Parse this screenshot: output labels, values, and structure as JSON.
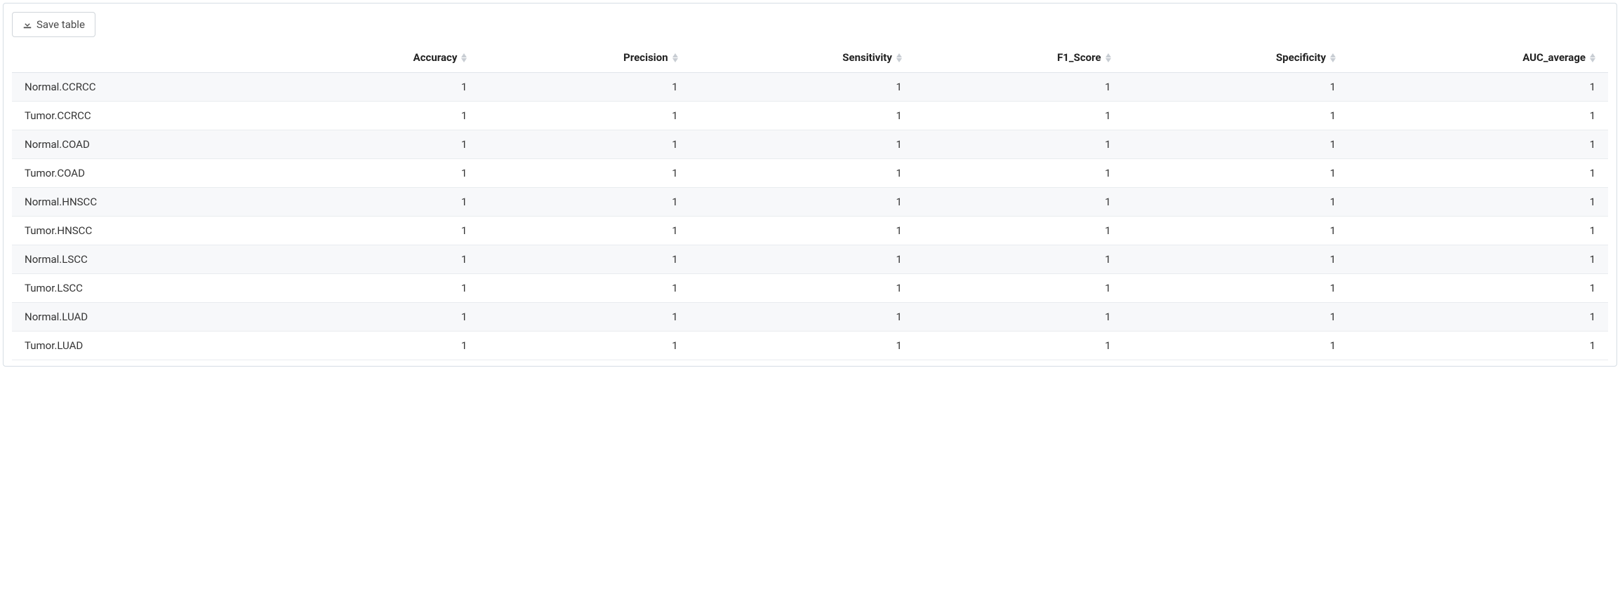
{
  "toolbar": {
    "save_label": "Save table"
  },
  "table": {
    "columns": [
      "",
      "Accuracy",
      "Precision",
      "Sensitivity",
      "F1_Score",
      "Specificity",
      "AUC_average"
    ],
    "rows": [
      {
        "label": "Normal.CCRCC",
        "values": [
          "1",
          "1",
          "1",
          "1",
          "1",
          "1"
        ]
      },
      {
        "label": "Tumor.CCRCC",
        "values": [
          "1",
          "1",
          "1",
          "1",
          "1",
          "1"
        ]
      },
      {
        "label": "Normal.COAD",
        "values": [
          "1",
          "1",
          "1",
          "1",
          "1",
          "1"
        ]
      },
      {
        "label": "Tumor.COAD",
        "values": [
          "1",
          "1",
          "1",
          "1",
          "1",
          "1"
        ]
      },
      {
        "label": "Normal.HNSCC",
        "values": [
          "1",
          "1",
          "1",
          "1",
          "1",
          "1"
        ]
      },
      {
        "label": "Tumor.HNSCC",
        "values": [
          "1",
          "1",
          "1",
          "1",
          "1",
          "1"
        ]
      },
      {
        "label": "Normal.LSCC",
        "values": [
          "1",
          "1",
          "1",
          "1",
          "1",
          "1"
        ]
      },
      {
        "label": "Tumor.LSCC",
        "values": [
          "1",
          "1",
          "1",
          "1",
          "1",
          "1"
        ]
      },
      {
        "label": "Normal.LUAD",
        "values": [
          "1",
          "1",
          "1",
          "1",
          "1",
          "1"
        ]
      },
      {
        "label": "Tumor.LUAD",
        "values": [
          "1",
          "1",
          "1",
          "1",
          "1",
          "1"
        ]
      }
    ]
  }
}
